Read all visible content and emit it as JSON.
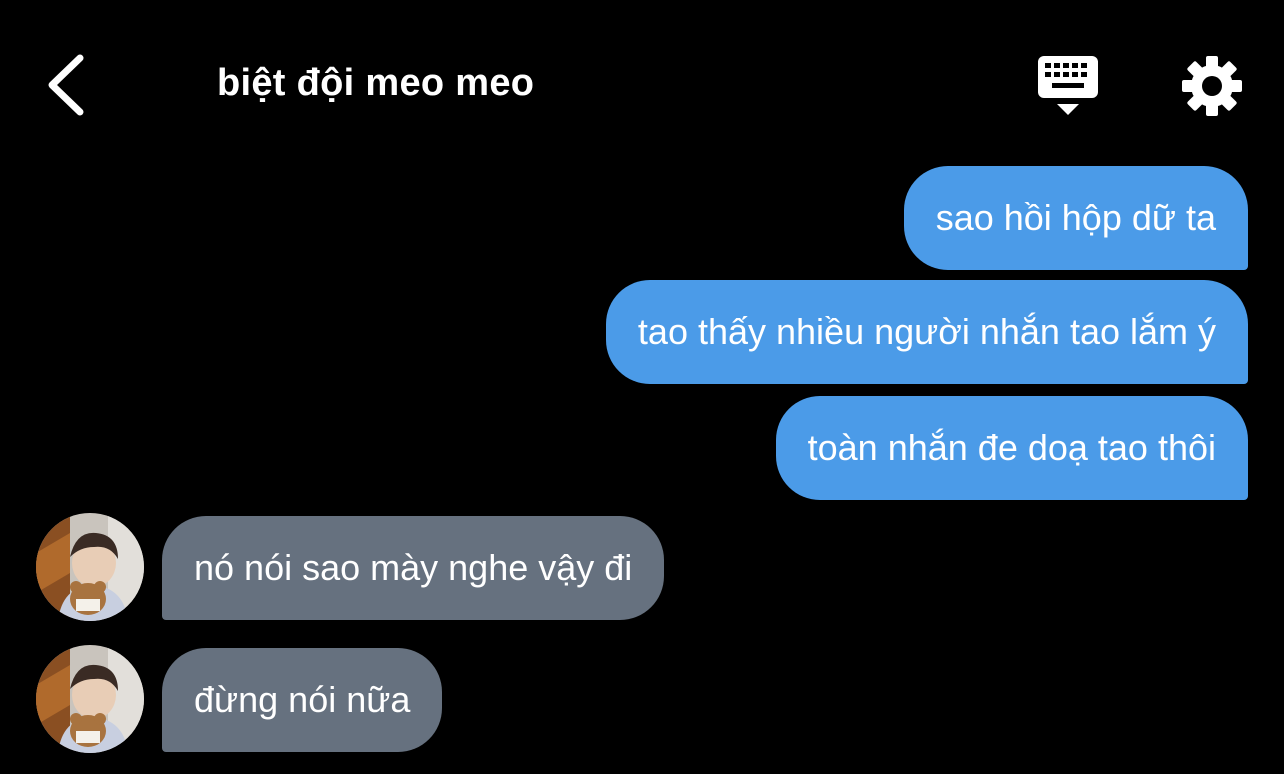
{
  "header": {
    "title": "biệt đội meo meo",
    "back_icon": "chevron-left-icon",
    "keyboard_icon": "keyboard-hide-icon",
    "settings_icon": "gear-icon"
  },
  "colors": {
    "background": "#000000",
    "outgoing_bubble": "#4b9be8",
    "incoming_bubble": "#66717f",
    "text": "#ffffff"
  },
  "messages": [
    {
      "direction": "outgoing",
      "text": "sao hồi hộp dữ ta"
    },
    {
      "direction": "outgoing",
      "text": "tao thấy nhiều người nhắn tao lắm ý"
    },
    {
      "direction": "outgoing",
      "text": "toàn nhắn đe doạ tao thôi"
    },
    {
      "direction": "incoming",
      "text": "nó nói sao mày nghe vậy đi",
      "avatar": "avatar"
    },
    {
      "direction": "incoming",
      "text": "đừng nói nữa",
      "avatar": "avatar"
    }
  ]
}
